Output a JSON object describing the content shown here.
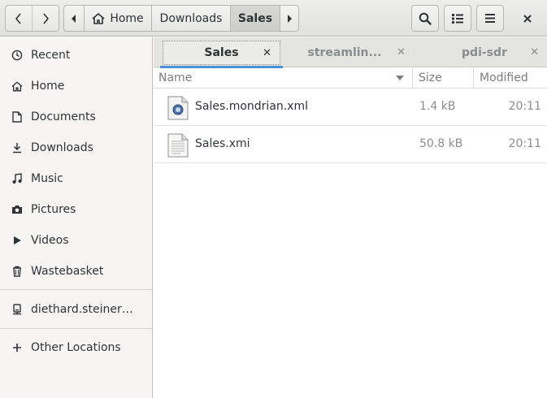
{
  "header": {
    "crumbs": {
      "home": "Home",
      "downloads": "Downloads",
      "sales": "Sales"
    }
  },
  "sidebar": {
    "items": [
      {
        "label": "Recent",
        "icon": "clock-icon"
      },
      {
        "label": "Home",
        "icon": "home-icon"
      },
      {
        "label": "Documents",
        "icon": "document-icon"
      },
      {
        "label": "Downloads",
        "icon": "download-icon"
      },
      {
        "label": "Music",
        "icon": "music-icon"
      },
      {
        "label": "Pictures",
        "icon": "camera-icon"
      },
      {
        "label": "Videos",
        "icon": "video-icon"
      },
      {
        "label": "Wastebasket",
        "icon": "trash-icon"
      }
    ],
    "network": {
      "label": "diethard.steiner@b...",
      "icon": "network-drive-icon"
    },
    "other": {
      "label": "Other Locations",
      "icon": "plus-icon"
    }
  },
  "tabs": [
    {
      "label": "Sales",
      "active": true
    },
    {
      "label": "streamlin...",
      "active": false
    },
    {
      "label": "pdi-sdr",
      "active": false
    }
  ],
  "columns": {
    "name": "Name",
    "size": "Size",
    "modified": "Modified"
  },
  "files": [
    {
      "name": "Sales.mondrian.xml",
      "size": "1.4 kB",
      "modified": "20:11",
      "icon": "xml-file-icon"
    },
    {
      "name": "Sales.xmi",
      "size": "50.8 kB",
      "modified": "20:11",
      "icon": "text-file-icon"
    }
  ],
  "colors": {
    "accent": "#4a90d9",
    "sidebar_bg": "#f6f5f4",
    "header_bg": "#e8e8e6"
  }
}
